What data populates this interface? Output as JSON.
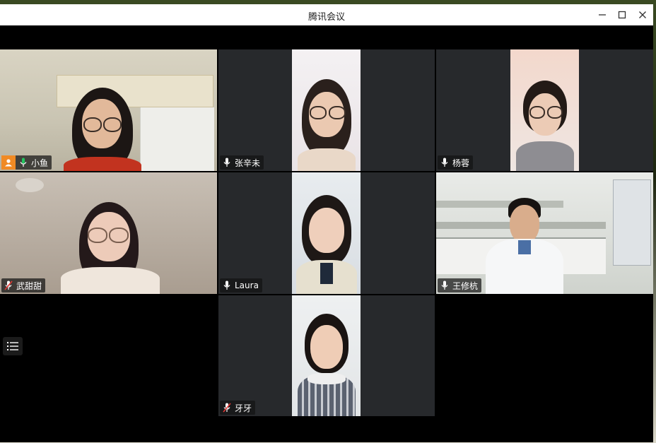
{
  "window": {
    "title": "腾讯会议",
    "controls": {
      "minimize": "minimize-icon",
      "maximize": "maximize-icon",
      "close": "close-icon"
    }
  },
  "participants": [
    {
      "name": "小鱼",
      "mic": "on",
      "host": true,
      "active_speaker": true
    },
    {
      "name": "张辛未",
      "mic": "on",
      "host": false,
      "active_speaker": false
    },
    {
      "name": "杨蓉",
      "mic": "on",
      "host": false,
      "active_speaker": false
    },
    {
      "name": "武甜甜",
      "mic": "muted",
      "host": false,
      "active_speaker": false
    },
    {
      "name": "Laura",
      "mic": "on",
      "host": false,
      "active_speaker": false
    },
    {
      "name": "王修杭",
      "mic": "on",
      "host": false,
      "active_speaker": false
    },
    {
      "name": "牙牙",
      "mic": "muted",
      "host": false,
      "active_speaker": false
    }
  ],
  "toolbar": {
    "menu_icon": "list-menu-icon"
  },
  "colors": {
    "active_border": "#1fbf45",
    "host_badge": "#f08a24",
    "tile_bg": "#27292c"
  }
}
